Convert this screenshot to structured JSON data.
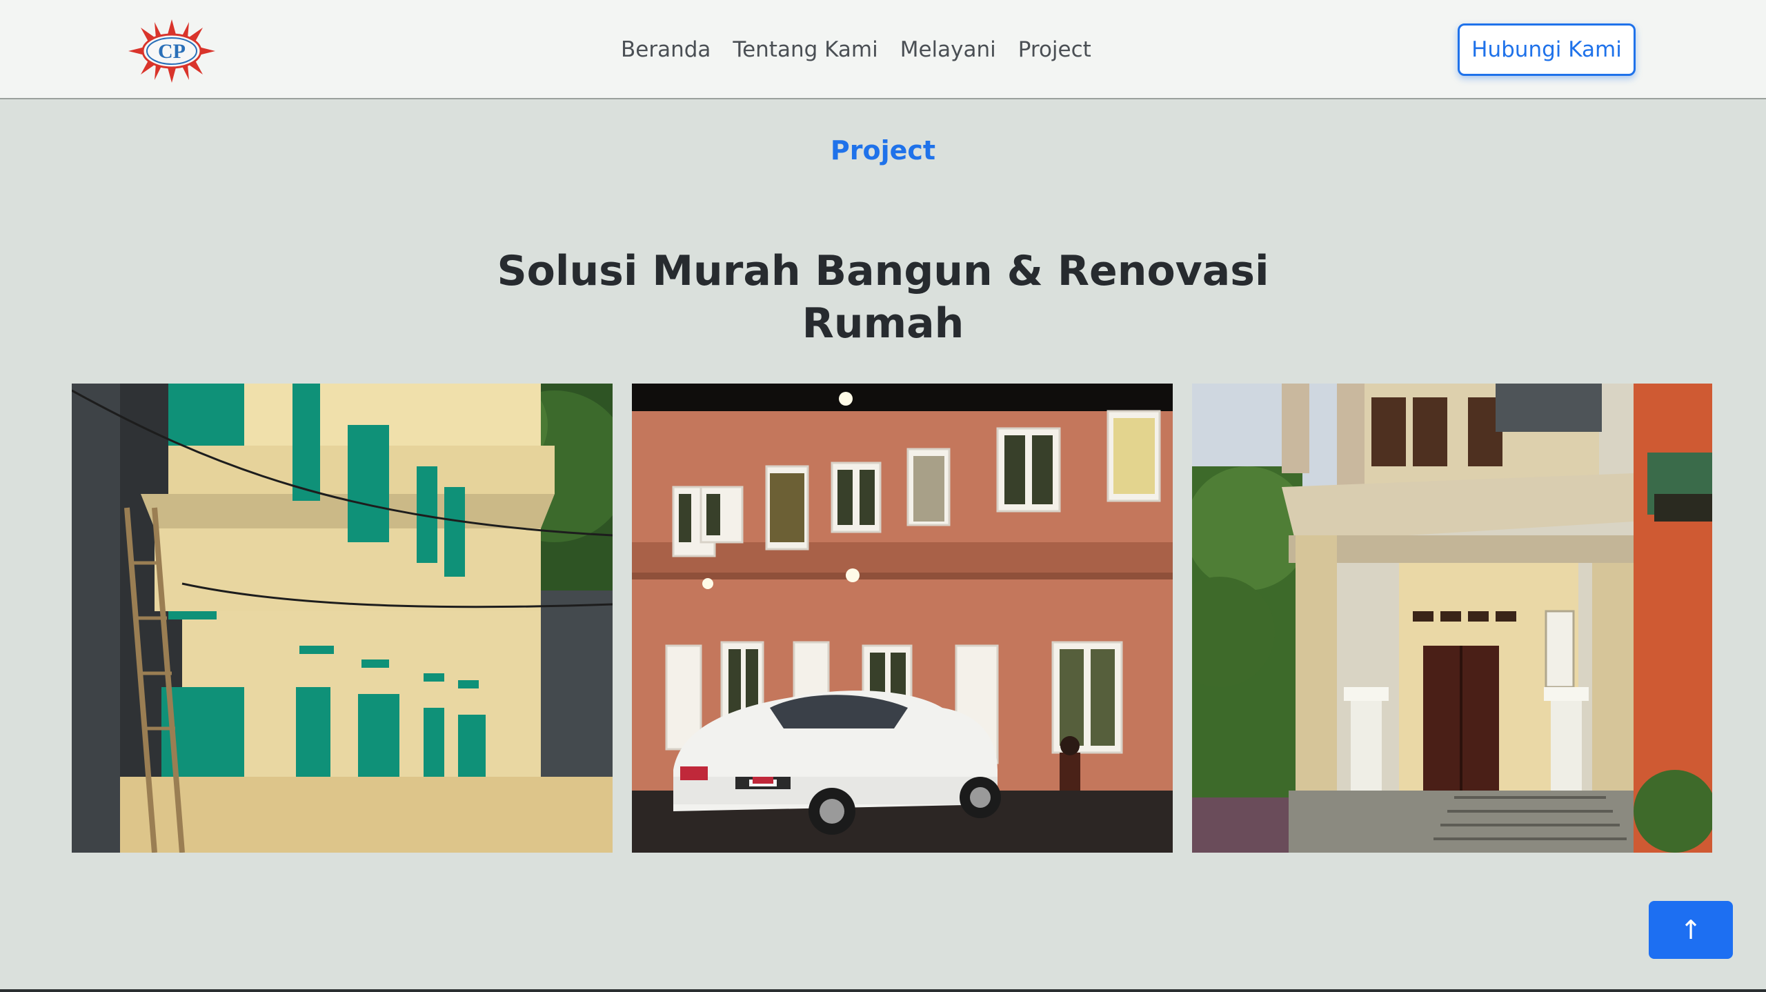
{
  "brand": {
    "logo_text": "CP"
  },
  "nav": {
    "links": [
      "Beranda",
      "Tentang Kami",
      "Melayani",
      "Project"
    ],
    "cta_label": "Hubungi Kami"
  },
  "section": {
    "label": "Project",
    "heading": "Solusi Murah Bangun & Renovasi Rumah"
  },
  "gallery": {
    "photos": [
      {
        "subject": "two-story building with green windows"
      },
      {
        "subject": "terracotta two-story building at night with white car"
      },
      {
        "subject": "beige two-story house with covered porch"
      }
    ]
  },
  "scroll_top": {
    "icon": "arrow-up-icon",
    "label": "↑"
  },
  "colors": {
    "accent": "#1f72ea",
    "page_bg": "#dae0dc",
    "nav_bg": "#f3f5f3",
    "heading": "#272b2f"
  }
}
